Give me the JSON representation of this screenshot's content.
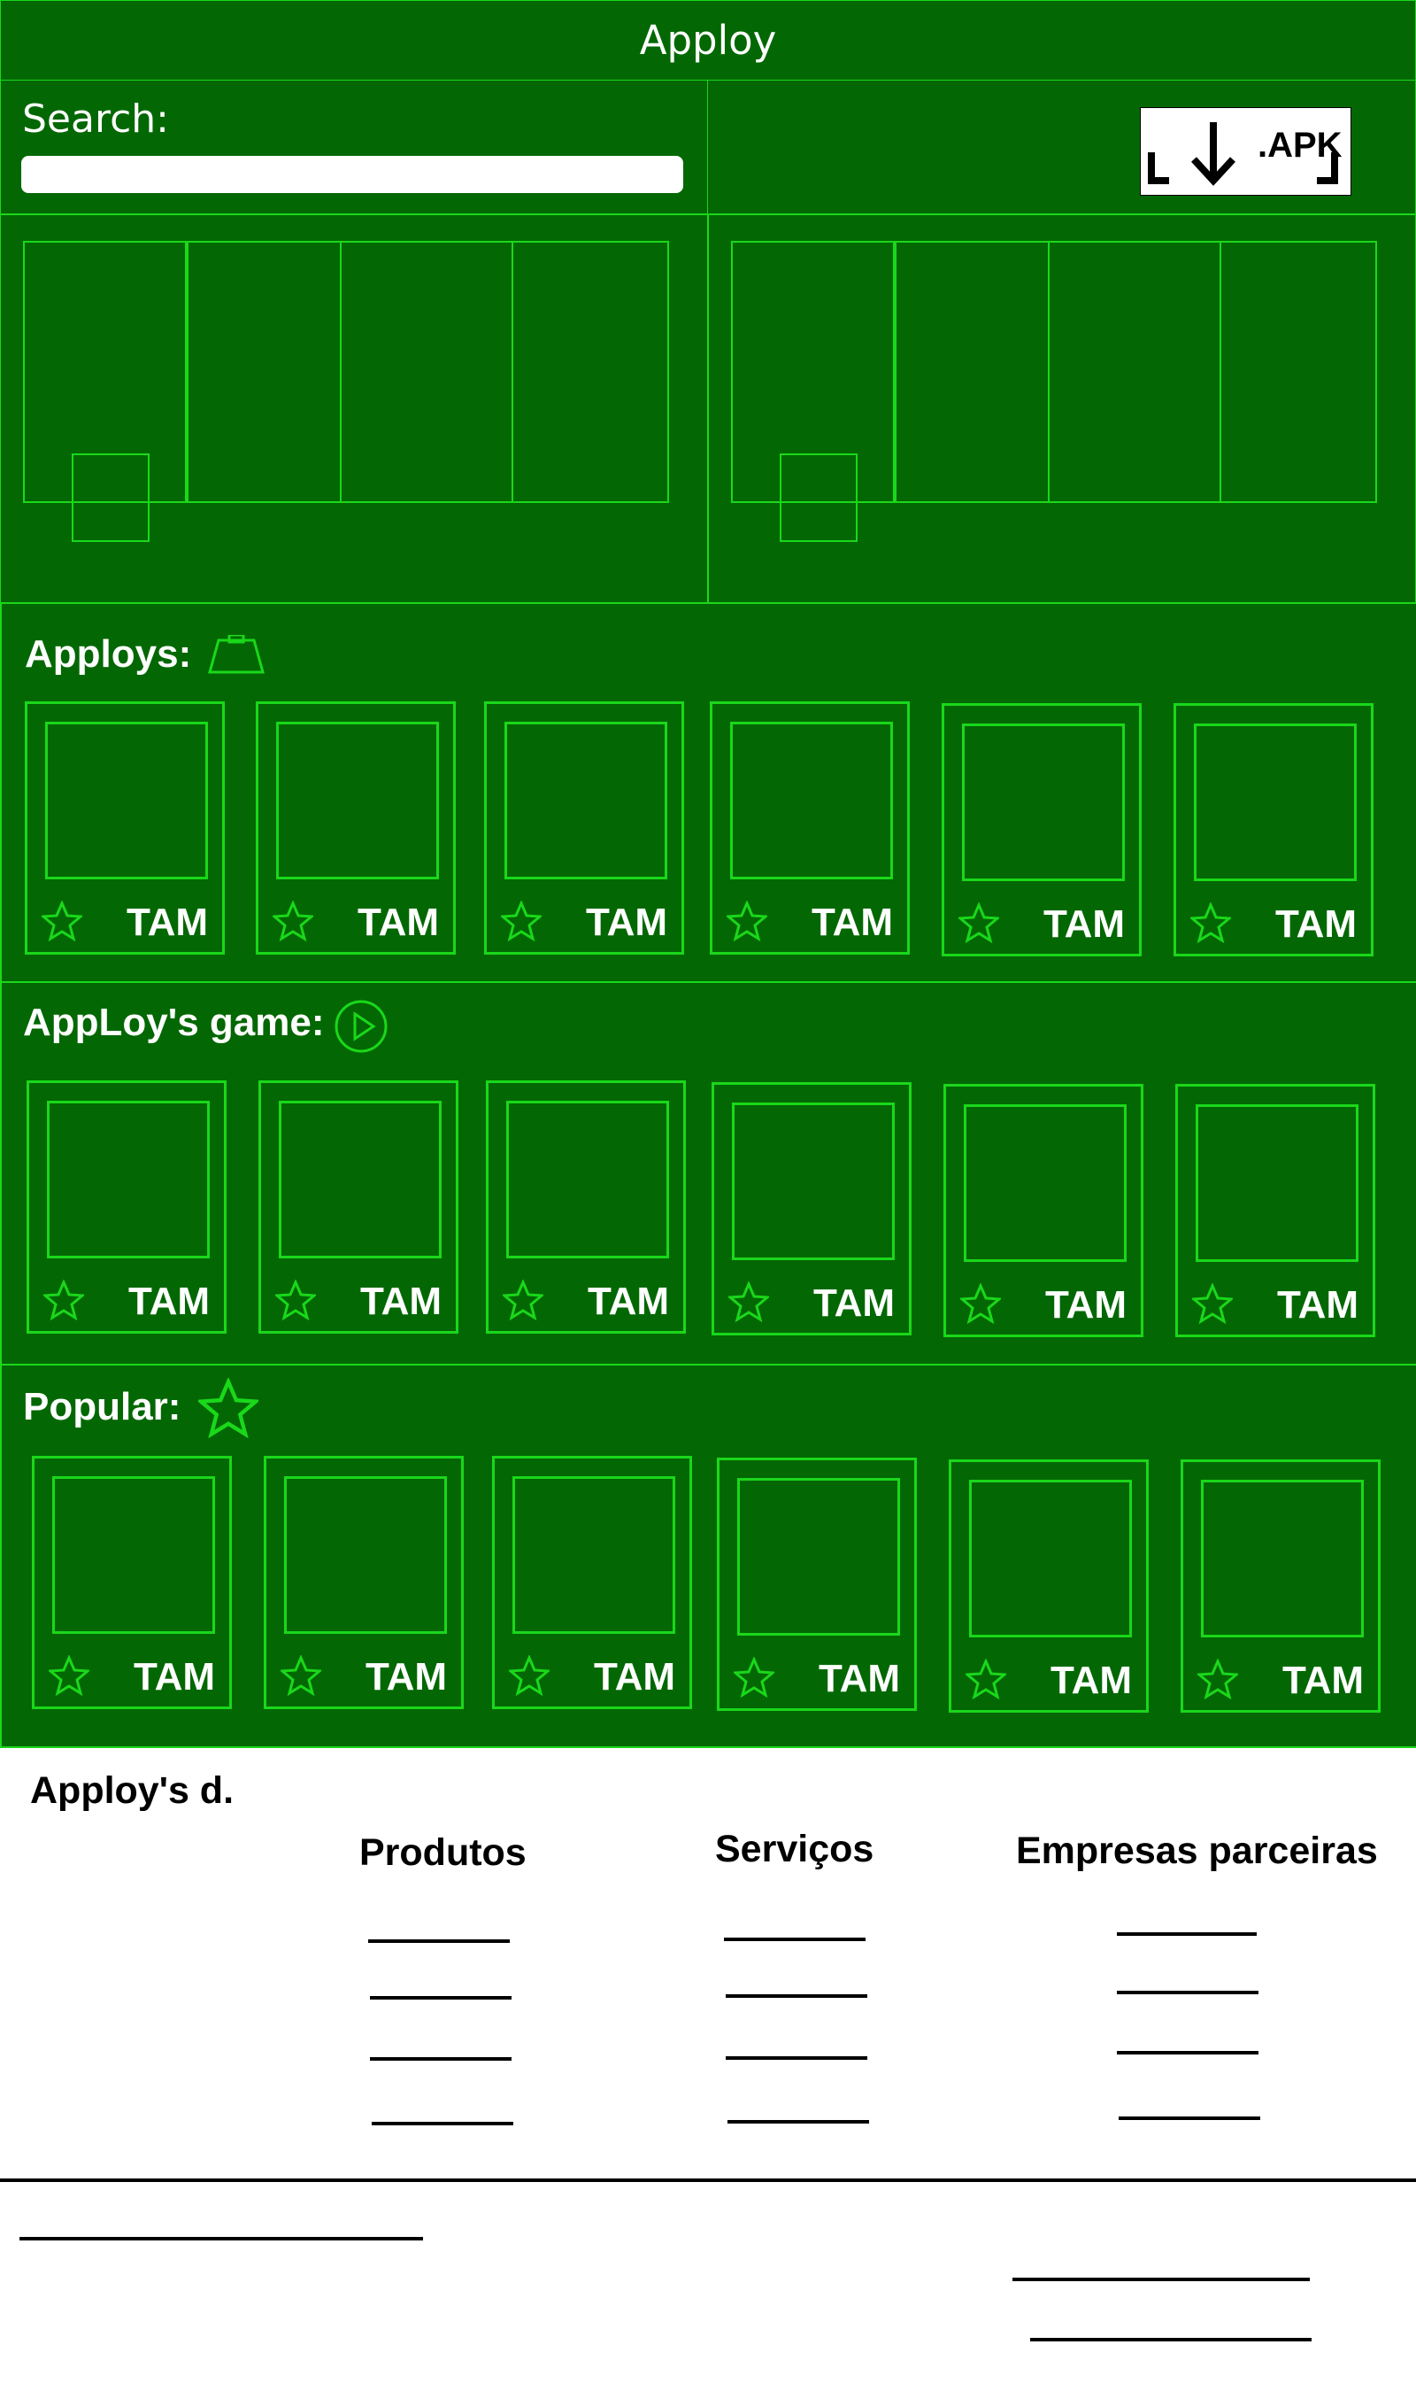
{
  "app": {
    "title": "Apploy"
  },
  "search": {
    "label": "Search:",
    "placeholder": ""
  },
  "download": {
    "label": ".APK",
    "icon": "download-arrow-icon"
  },
  "sections": [
    {
      "title": "Apploys:",
      "icon": "weight-icon",
      "cards": [
        "TAM",
        "TAM",
        "TAM",
        "TAM",
        "TAM",
        "TAM"
      ]
    },
    {
      "title": "AppLoy's game:",
      "icon": "play-circle-icon",
      "cards": [
        "TAM",
        "TAM",
        "TAM",
        "TAM",
        "TAM",
        "TAM"
      ]
    },
    {
      "title": "Popular:",
      "icon": "star-icon",
      "cards": [
        "TAM",
        "TAM",
        "TAM",
        "TAM",
        "TAM",
        "TAM"
      ]
    }
  ],
  "footer": {
    "title": "Apploy's d.",
    "columns": [
      "Produtos",
      "Serviços",
      "Empresas parceiras"
    ]
  },
  "colors": {
    "background": "#036803",
    "accent": "#1ad81a",
    "text": "#ffffff"
  }
}
